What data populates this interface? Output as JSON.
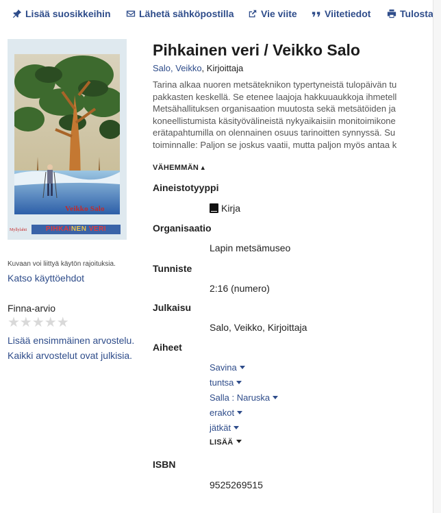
{
  "toolbar": {
    "favorite": "Lisää suosikkeihin",
    "email": "Lähetä sähköpostilla",
    "export": "Vie viite",
    "cite": "Viitetiedot",
    "print": "Tulosta"
  },
  "cover": {
    "author_text": "Veikko Salo",
    "title_part1": "PIHKAI",
    "title_part2": "NEN",
    "title_part3": "VERI",
    "publisher": "Myllylahti"
  },
  "left": {
    "image_note": "Kuvaan voi liittyä käytön rajoituksia.",
    "terms_link": "Katso käyttöehdot",
    "rating_label": "Finna-arvio",
    "stars": "★★★★★",
    "rating_value": 0,
    "add_review": "Lisää ensimmäinen arvostelu.",
    "reviews_public": "Kaikki arvostelut ovat julkisia."
  },
  "record": {
    "title": "Pihkainen veri / Veikko Salo",
    "author_link": "Salo, Veikko",
    "author_role": ", Kirjoittaja",
    "summary_lines": [
      "Tarina alkaa nuoren metsäteknikon typertyneistä tulopäivän tu",
      "pakkasten keskellä. Se etenee laajoja hakkuuaukkoja ihmetell",
      "Metsähallituksen organisaation muutosta sekä metsätöiden ja",
      "koneellistumista käsityövälineistä nykyaikaisiin monitoimikone",
      "erätapahtumilla on olennainen osuus tarinoitten synnyssä. Su",
      "toiminnalle: Paljon se joskus vaatii, mutta paljon myös antaa k"
    ],
    "less_toggle": "VÄHEMMÄN ▴"
  },
  "fields": {
    "format_label": "Aineistotyyppi",
    "format_value": "Kirja",
    "org_label": "Organisaatio",
    "org_value": "Lapin metsämuseo",
    "id_label": "Tunniste",
    "id_value": "2:16 (numero)",
    "pub_label": "Julkaisu",
    "pub_value": "Salo, Veikko, Kirjoittaja",
    "subjects_label": "Aiheet",
    "subjects": [
      "Savina",
      "tuntsa",
      "Salla : Naruska",
      "erakot",
      "jätkät"
    ],
    "more_toggle": "LISÄÄ",
    "isbn_label": "ISBN",
    "isbn_value": "9525269515"
  }
}
